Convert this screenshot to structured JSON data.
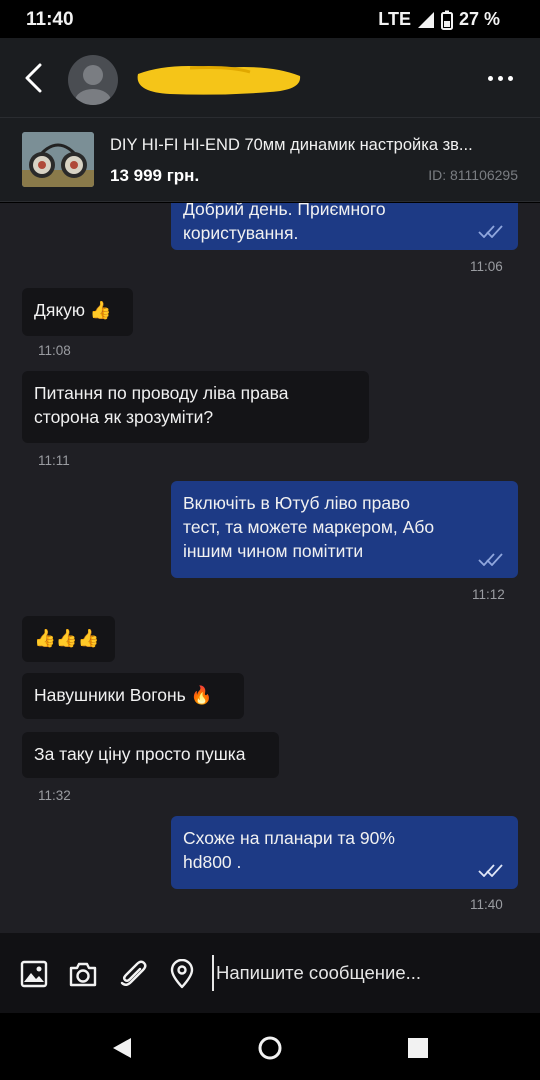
{
  "status_bar": {
    "time": "11:40",
    "network": "LTE",
    "battery": "27 %"
  },
  "header": {
    "contact_name": "",
    "back_icon": "chevron-left-icon",
    "more_icon": "more-horizontal-icon"
  },
  "product": {
    "title": "DIY HI-FI HI-END 70мм динамик настройка зв...",
    "price": "13 999 грн.",
    "id": "ID: 811106295"
  },
  "messages": [
    {
      "direction": "out",
      "text": "Добрий день. Приємного\nкористування.",
      "time": "11:06",
      "read": true
    },
    {
      "direction": "in",
      "text": "Дякую 👍",
      "time": "11:08"
    },
    {
      "direction": "in",
      "text": "Питання по проводу ліва права\nсторона як зрозуміти?",
      "time": "11:11"
    },
    {
      "direction": "out",
      "text": "Включіть в Ютуб ліво право\nтест, та можете маркером, Або\nіншим чином помітити",
      "time": "11:12",
      "read": true
    },
    {
      "direction": "in",
      "text": "👍👍👍",
      "time": ""
    },
    {
      "direction": "in",
      "text": "Навушники Вогонь 🔥",
      "time": ""
    },
    {
      "direction": "in",
      "text": "За таку ціну просто пушка",
      "time": "11:32"
    },
    {
      "direction": "out",
      "text": "Схоже  на планари та 90%\nhd800 .",
      "time": "11:40",
      "read": true
    }
  ],
  "composer": {
    "placeholder": "Напишите сообщение...",
    "icons": [
      "image-icon",
      "camera-icon",
      "paperclip-icon",
      "location-pin-icon"
    ]
  },
  "colors": {
    "outgoing_bubble": "#1d3a85",
    "incoming_bubble": "#141417",
    "chat_background": "#1f1f24",
    "read_ticks": "#8fa6dd"
  }
}
